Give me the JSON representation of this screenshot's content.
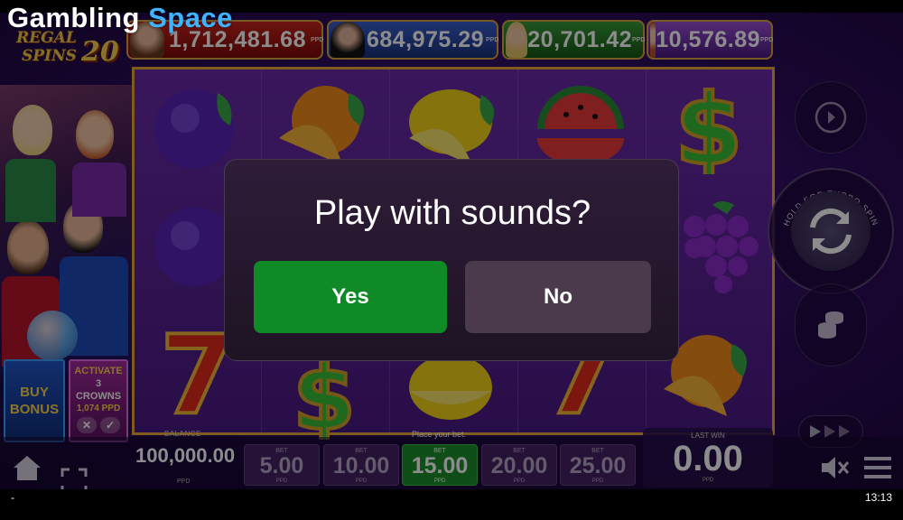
{
  "watermark": {
    "part1": "Gambling ",
    "part2": "Space"
  },
  "game_logo": {
    "line1": "REGAL",
    "line2": "SPINS",
    "number": "20"
  },
  "jackpots": [
    {
      "value": "1,712,481.68",
      "unit": "PPD",
      "color": "#c9241c"
    },
    {
      "value": "684,975.29",
      "unit": "PPD",
      "color": "#3a5fd0"
    },
    {
      "value": "20,701.42",
      "unit": "PPD",
      "color": "#3a9a3a"
    },
    {
      "value": "10,576.89",
      "unit": "PPD",
      "color": "#9b4fd6"
    }
  ],
  "reels": {
    "symbols": [
      [
        "plum",
        "orange",
        "lemon",
        "watermelon",
        "dollar"
      ],
      [
        "plum",
        "",
        "",
        "",
        "grapes"
      ],
      [
        "seven",
        "dollar",
        "lemon",
        "seven",
        "orange"
      ]
    ]
  },
  "buy_bonus": {
    "line1": "BUY",
    "line2": "BONUS"
  },
  "activate": {
    "line1": "ACTIVATE",
    "line2": "3",
    "line3": "CROWNS",
    "price": "1,074 PPD",
    "cancel": "✕",
    "confirm": "✓"
  },
  "balance": {
    "label": "BALANCE",
    "value": "100,000.00",
    "unit": "PPD"
  },
  "place_bet_label": "Place your bet.",
  "bets": [
    {
      "label": "BET",
      "value": "5.00",
      "unit": "PPD",
      "active": false
    },
    {
      "label": "BET",
      "value": "10.00",
      "unit": "PPD",
      "active": false
    },
    {
      "label": "BET",
      "value": "15.00",
      "unit": "PPD",
      "active": true
    },
    {
      "label": "BET",
      "value": "20.00",
      "unit": "PPD",
      "active": false
    },
    {
      "label": "BET",
      "value": "25.00",
      "unit": "PPD",
      "active": false
    }
  ],
  "last_win": {
    "label": "LAST WIN",
    "value": "0.00",
    "unit": "PPD"
  },
  "controls": {
    "turbo_label": "HOLD FOR TURBO SPIN"
  },
  "dialog": {
    "title": "Play with sounds?",
    "yes": "Yes",
    "no": "No"
  },
  "statusbar": {
    "left": "-",
    "time": "13:13"
  },
  "colors": {
    "accent_green": "#0f8a27",
    "reel_frame": "#e7a638",
    "background": "#2c0c5a"
  }
}
